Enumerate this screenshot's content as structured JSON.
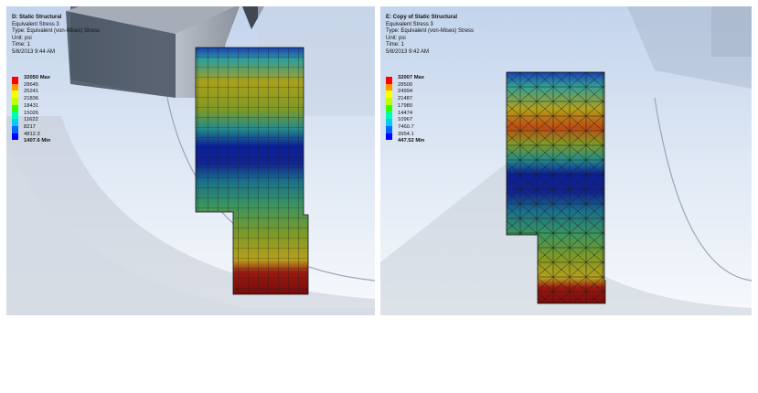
{
  "legend_colors": [
    "#ff0000",
    "#ff9900",
    "#ffff00",
    "#bfff00",
    "#33ff00",
    "#00ffaa",
    "#00ccff",
    "#0066ff",
    "#0000ff"
  ],
  "left": {
    "title": "D: Static Structural",
    "result": "Equivalent Stress 3",
    "type": "Type: Equivalent (von-Mises) Stress",
    "unit": "Unit: psi",
    "time": "Time: 1",
    "date": "5/8/2013 9:44 AM",
    "legend_max": "32050 Max",
    "legend_values": [
      "28645",
      "25241",
      "21836",
      "18431",
      "15026",
      "11622",
      "8217",
      "4812.3"
    ],
    "legend_min": "1407.6 Min"
  },
  "right": {
    "title": "E: Copy of Static Structural",
    "result": "Equivalent Stress 3",
    "type": "Type: Equivalent (von-Mises) Stress",
    "unit": "Unit: psi",
    "time": "Time: 1",
    "date": "5/8/2013 9:42 AM",
    "legend_max": "32007 Max",
    "legend_values": [
      "28500",
      "24994",
      "21487",
      "17980",
      "14474",
      "10967",
      "7460.7",
      "3954.1"
    ],
    "legend_min": "447.52 Min"
  }
}
